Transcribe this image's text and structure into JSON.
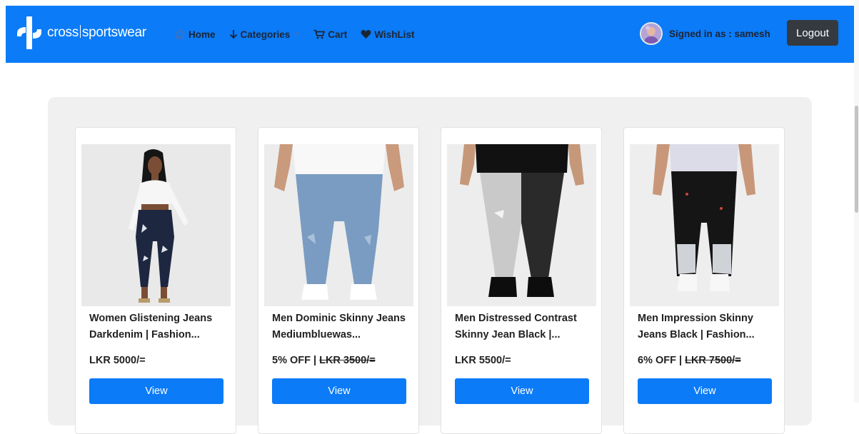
{
  "brand": {
    "name_left": "cross",
    "name_right": "sportswear"
  },
  "nav": {
    "home": "Home",
    "categories": "Categories",
    "cart": "Cart",
    "wishlist": "WishList"
  },
  "user": {
    "signed_in_label": "Signed in as : samesh"
  },
  "logout_label": "Logout",
  "colors": {
    "navbar": "#0b7bf7",
    "button": "#0b7bf7",
    "logout": "#343a40",
    "panel": "#f0f0f0"
  },
  "products": [
    {
      "title": "Women Glistening Jeans Darkdenim | Fashion...",
      "discount": "",
      "price": "LKR 5000/=",
      "button": "View"
    },
    {
      "title": "Men Dominic Skinny Jeans Mediumbluewas...",
      "discount": "5% OFF | ",
      "price": "LKR 3500/=",
      "button": "View"
    },
    {
      "title": "Men Distressed Contrast Skinny Jean Black |...",
      "discount": "",
      "price": "LKR 5500/=",
      "button": "View"
    },
    {
      "title": "Men Impression Skinny Jeans Black | Fashion...",
      "discount": "6% OFF | ",
      "price": "LKR 7500/=",
      "button": "View"
    }
  ]
}
